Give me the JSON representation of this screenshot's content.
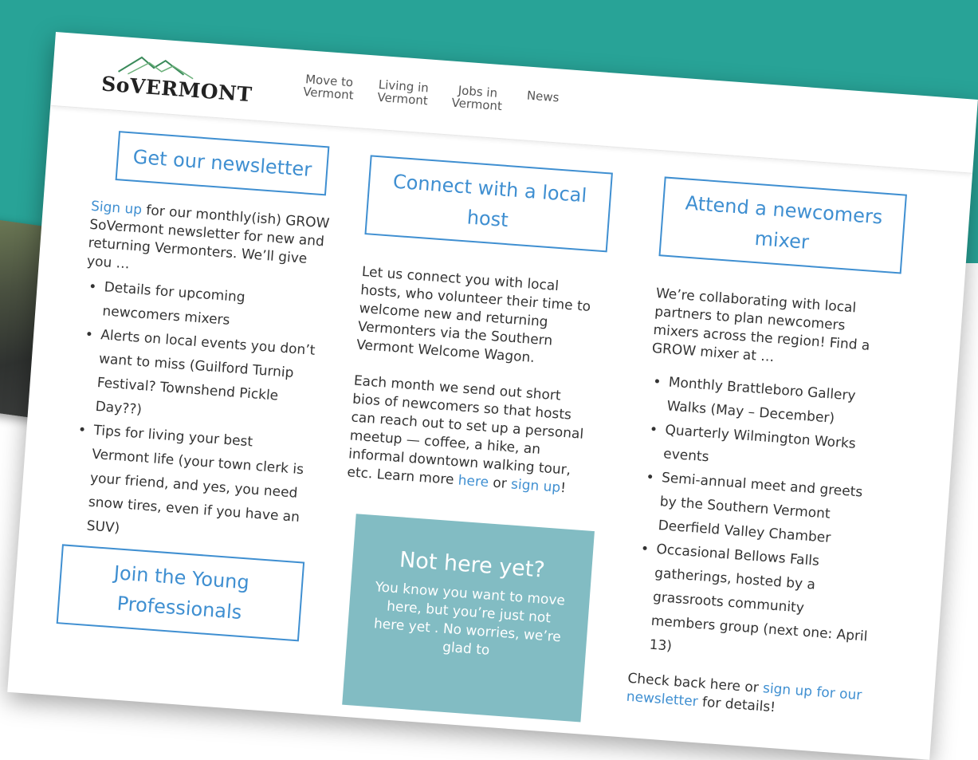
{
  "brand": {
    "logo_text": "SoVERMONT",
    "accent": "#3f8fd1",
    "header_band": "#28a397"
  },
  "nav": {
    "items": [
      {
        "label": "Move to\nVermont"
      },
      {
        "label": "Living in\nVermont"
      },
      {
        "label": "Jobs in\nVermont"
      },
      {
        "label": "News"
      }
    ]
  },
  "newsletter": {
    "button": "Get our newsletter",
    "intro_link": "Sign up",
    "intro_text": " for our monthly(ish) GROW SoVermont newsletter for new and returning Vermonters. We’ll give you …",
    "bullets": [
      "Details for upcoming newcomers mixers",
      "Alerts on local events you don’t want to miss (Guilford Turnip Festival? Townshend Pickle Day??)",
      "Tips for living your best Vermont life (your town clerk is your friend, and yes, you need snow tires, even if you have an SUV)"
    ]
  },
  "host": {
    "button": "Connect with a local host",
    "para1": "Let us connect you with local hosts, who volunteer their time to welcome new and returning Vermonters via the Southern Vermont Welcome Wagon.",
    "para2": "Each month we send out short bios of newcomers so that hosts can reach out to set up a personal meetup — coffee, a hike, an informal downtown walking tour, etc. Learn more ",
    "link_here": "here",
    "or_text": " or ",
    "link_signup": "sign up",
    "end_text": "!"
  },
  "mixer": {
    "button": "Attend a newcomers mixer",
    "intro": "We’re collaborating with local partners to plan newcomers mixers across the region! Find a GROW mixer at …",
    "bullets": [
      "Monthly Brattleboro Gallery Walks (May – December)",
      "Quarterly Wilmington Works events",
      "Semi-annual meet and greets by the Southern Vermont Deerfield Valley Chamber",
      "Occasional Bellows Falls gatherings, hosted by a grassroots community members group (next one: April 13)"
    ],
    "tail_pre": "Check back here or ",
    "tail_link": "sign up for our newsletter",
    "tail_post": " for details!"
  },
  "young": {
    "button": "Join the Young Professionals"
  },
  "not_here": {
    "title": "Not here yet?",
    "text": "You know you want to move here, but you’re just not here yet . No worries, we’re glad to"
  }
}
